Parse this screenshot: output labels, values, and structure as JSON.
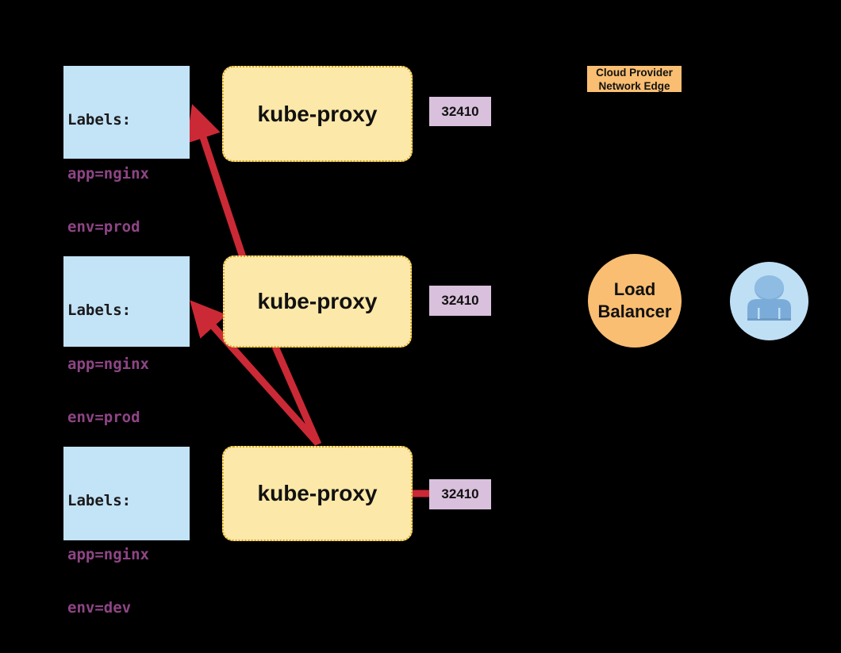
{
  "diagram": {
    "title": "kube-proxy NodePort service diagram",
    "background_color": "#000000",
    "colors": {
      "label_box_fill": "#C3E3F7",
      "label_key_text": "#8E4585",
      "label_title_text": "#1A1A1A",
      "node_fill": "#FCE8A8",
      "node_border": "#D8A81A",
      "port_badge_fill": "#D9C0DC",
      "accent_orange": "#F9BE72",
      "arrow_red": "#CC2936",
      "avatar_circle": "#BFDFF5",
      "avatar_person": "#7BACD9"
    }
  },
  "label_boxes": [
    {
      "id": "label-box-top",
      "title": "Labels:",
      "pairs": [
        "app=nginx",
        "env=prod"
      ]
    },
    {
      "id": "label-box-middle",
      "title": "Labels:",
      "pairs": [
        "app=nginx",
        "env=prod"
      ]
    },
    {
      "id": "label-box-bottom",
      "title": "Labels:",
      "pairs": [
        "app=nginx",
        "env=dev"
      ]
    }
  ],
  "nodes": [
    {
      "id": "node-top",
      "label": "kube-proxy"
    },
    {
      "id": "node-middle",
      "label": "kube-proxy"
    },
    {
      "id": "node-bottom",
      "label": "kube-proxy"
    }
  ],
  "ports": [
    {
      "id": "port-top",
      "value": "32410"
    },
    {
      "id": "port-middle",
      "value": "32410"
    },
    {
      "id": "port-bottom",
      "value": "32410"
    }
  ],
  "cloud_edge": {
    "line1": "Cloud Provider",
    "line2": "Network Edge"
  },
  "load_balancer": {
    "line1": "Load",
    "line2": "Balancer"
  },
  "user": {
    "icon": "user-person-icon"
  }
}
